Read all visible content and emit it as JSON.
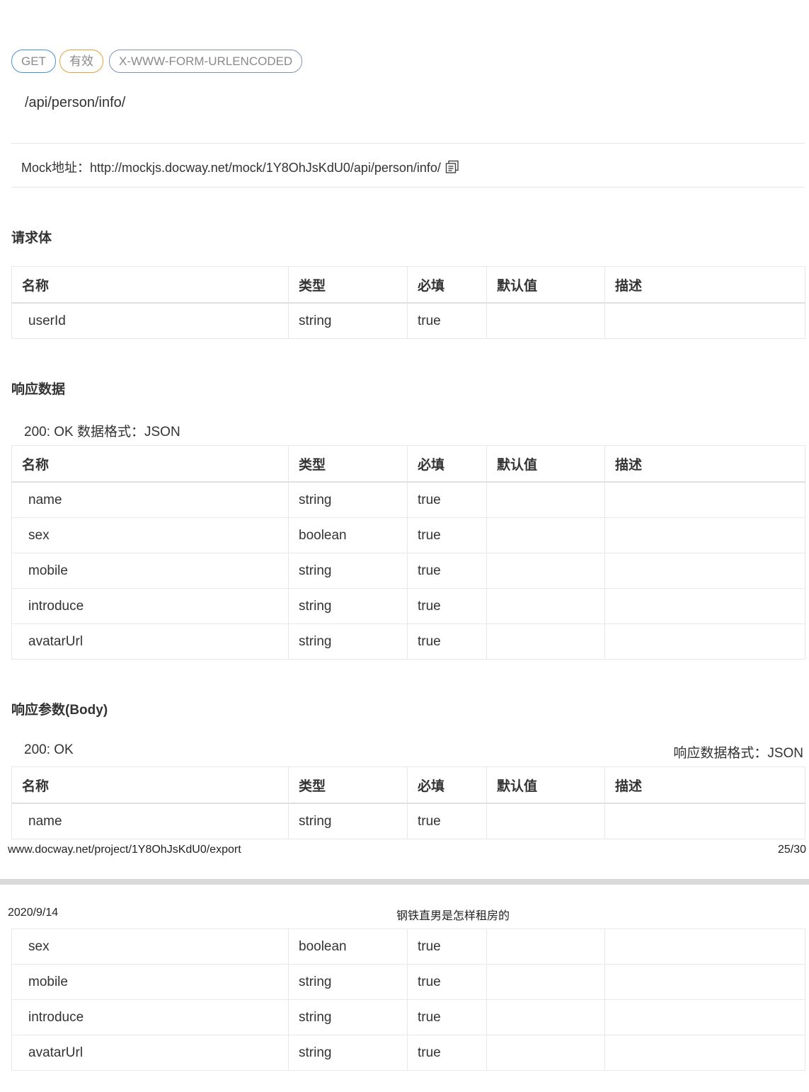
{
  "tags": {
    "method": "GET",
    "status": "有效",
    "content_type": "X-WWW-FORM-URLENCODED"
  },
  "api_path": "/api/person/info/",
  "mock": {
    "label": "Mock地址：",
    "url": "http://mockjs.docway.net/mock/1Y8OhJsKdU0/api/person/info/"
  },
  "columns": [
    "名称",
    "类型",
    "必填",
    "默认值",
    "描述"
  ],
  "request_body": {
    "title": "请求体",
    "rows": [
      {
        "name": "userId",
        "type": "string",
        "required": "true",
        "default": "",
        "desc": ""
      }
    ]
  },
  "response_data": {
    "title": "响应数据",
    "status": "200: OK  数据格式：JSON",
    "rows": [
      {
        "name": "name",
        "type": "string",
        "required": "true",
        "default": "",
        "desc": ""
      },
      {
        "name": "sex",
        "type": "boolean",
        "required": "true",
        "default": "",
        "desc": ""
      },
      {
        "name": "mobile",
        "type": "string",
        "required": "true",
        "default": "",
        "desc": ""
      },
      {
        "name": "introduce",
        "type": "string",
        "required": "true",
        "default": "",
        "desc": ""
      },
      {
        "name": "avatarUrl",
        "type": "string",
        "required": "true",
        "default": "",
        "desc": ""
      }
    ]
  },
  "response_body": {
    "title": "响应参数(Body)",
    "status": "200: OK",
    "format": "响应数据格式：JSON",
    "rows_page1": [
      {
        "name": "name",
        "type": "string",
        "required": "true",
        "default": "",
        "desc": ""
      }
    ],
    "rows_page2": [
      {
        "name": "sex",
        "type": "boolean",
        "required": "true",
        "default": "",
        "desc": ""
      },
      {
        "name": "mobile",
        "type": "string",
        "required": "true",
        "default": "",
        "desc": ""
      },
      {
        "name": "introduce",
        "type": "string",
        "required": "true",
        "default": "",
        "desc": ""
      },
      {
        "name": "avatarUrl",
        "type": "string",
        "required": "true",
        "default": "",
        "desc": ""
      }
    ]
  },
  "footer": {
    "url": "www.docway.net/project/1Y8OhJsKdU0/export",
    "page": "25/30"
  },
  "next_header": {
    "date": "2020/9/14",
    "title": "钢铁直男是怎样租房的"
  }
}
